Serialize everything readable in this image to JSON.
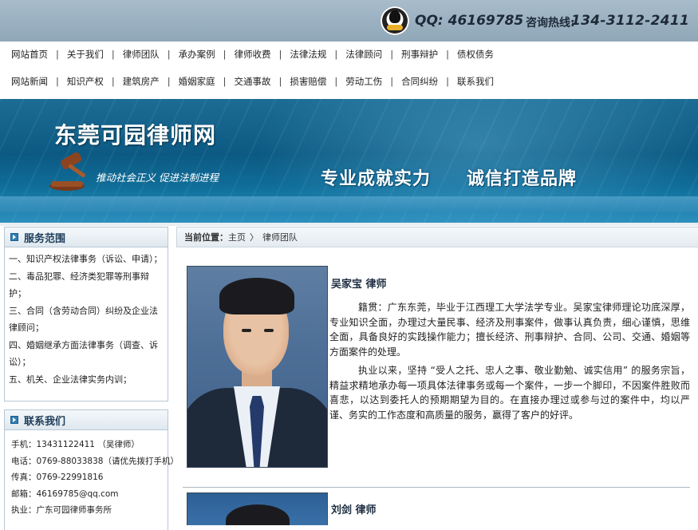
{
  "header": {
    "qq": "QQ: 46169785",
    "hotline_label": "咨询热线:",
    "hotline_number": "134-3112-2411"
  },
  "nav": {
    "row1": [
      "网站首页",
      "关于我们",
      "律师团队",
      "承办案例",
      "律师收费",
      "法律法规",
      "法律顾问",
      "刑事辩护",
      "债权债务"
    ],
    "row2": [
      "网站新闻",
      "知识产权",
      "建筑房产",
      "婚姻家庭",
      "交通事故",
      "损害赔偿",
      "劳动工伤",
      "合同纠纷",
      "联系我们"
    ]
  },
  "banner": {
    "site_title": "东莞可园律师网",
    "slogan": "推动社会正义   促进法制进程",
    "slogan_big_1": "专业成就实力",
    "slogan_big_2": "诚信打造品牌"
  },
  "sidebar": {
    "services_title": "服务范围",
    "services": [
      "一、知识产权法律事务（诉讼、申请）；",
      "二、毒品犯罪、经济类犯罪等刑事辩护；",
      "三、合同（含劳动合同）纠纷及企业法律顾问；",
      "四、婚姻继承方面法律事务（调查、诉讼）；",
      "五、机关、企业法律实务内训；"
    ],
    "contact_title": "联系我们",
    "contact": [
      "手机：13431122411 （吴律师）",
      "电话：0769-88033838（请优先拨打手机）",
      "传真：0769-22991816",
      "邮箱：46169785@qq.com",
      "执业：广东可园律师事务所"
    ]
  },
  "main": {
    "breadcrumb_label": "当前位置：",
    "breadcrumb_home": "主页",
    "breadcrumb_arrow": "〉",
    "breadcrumb_current": "律师团队",
    "lawyers": [
      {
        "name": "吴家宝  律师",
        "bio1": "籍贯：广东东莞，毕业于江西理工大学法学专业。吴家宝律师理论功底深厚，专业知识全面，办理过大量民事、经济及刑事案件，做事认真负责，细心谨慎，思维全面，具备良好的实践操作能力；擅长经济、刑事辩护、合同、公司、交通、婚姻等方面案件的处理。",
        "bio2": "执业以来，坚持 “受人之托、忠人之事、敬业勤勉、诚实信用” 的服务宗旨，精益求精地承办每一项具体法律事务或每一个案件，一步一个脚印，不因案件胜败而喜悲，以达到委托人的预期期望为目的。在直接办理过或参与过的案件中，均以严谨、务实的工作态度和高质量的服务，赢得了客户的好评。"
      },
      {
        "name": "刘剑  律师"
      }
    ]
  },
  "colors": {
    "banner_blue": "#0c5a83",
    "topbar": "#8fa7b8",
    "heading_dark": "#1d3c5a"
  }
}
